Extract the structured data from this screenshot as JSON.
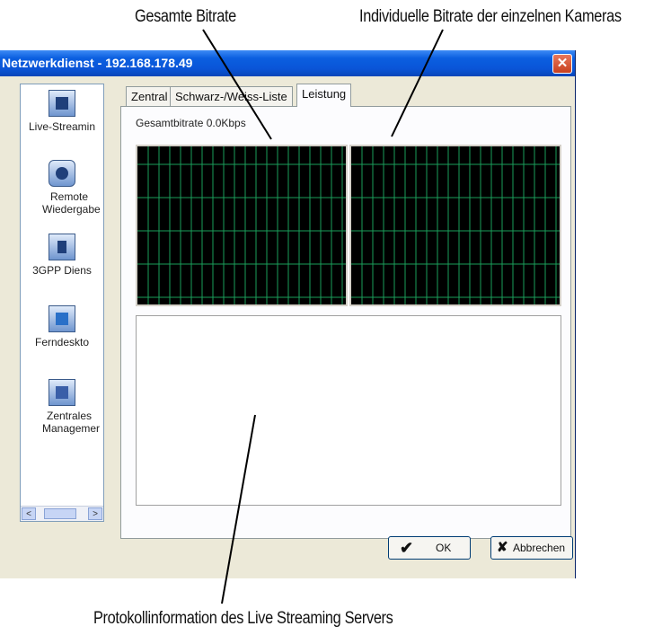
{
  "callouts": {
    "total_bitrate": "Gesamte Bitrate",
    "camera_bitrate": "Individuelle Bitrate der einzelnen Kameras",
    "log_info": "Protokollinformation des Live Streaming Servers"
  },
  "window": {
    "title": "Netzwerkdienst - 192.168.178.49",
    "close_glyph": "✕"
  },
  "sidebar": {
    "items": [
      {
        "label": "Live-Streamin",
        "icon": "monitor-icon"
      },
      {
        "label": "Remote Wiedergabe",
        "icon": "playback-icon"
      },
      {
        "label": "3GPP Diens",
        "icon": "mobile-icon"
      },
      {
        "label": "Ferndeskto",
        "icon": "remote-desktop-icon"
      },
      {
        "label": "Zentrales Managemer",
        "icon": "central-management-icon"
      }
    ],
    "scroll_left": "<",
    "scroll_right": ">"
  },
  "tabs": [
    {
      "label": "Zentral",
      "active": false
    },
    {
      "label": "Schwarz-/Weiss-Liste",
      "active": false
    },
    {
      "label": "Leistung",
      "active": true
    }
  ],
  "panel": {
    "total_bitrate_text": "Gesamtbitrate 0.0Kbps"
  },
  "buttons": {
    "ok_label": "OK",
    "ok_glyph": "✔",
    "cancel_label": "Abbrechen",
    "cancel_glyph": "✘"
  },
  "colors": {
    "graph_background": "#000000",
    "graph_grid": "#1a9e5a",
    "titlebar": "#0a55d8"
  }
}
